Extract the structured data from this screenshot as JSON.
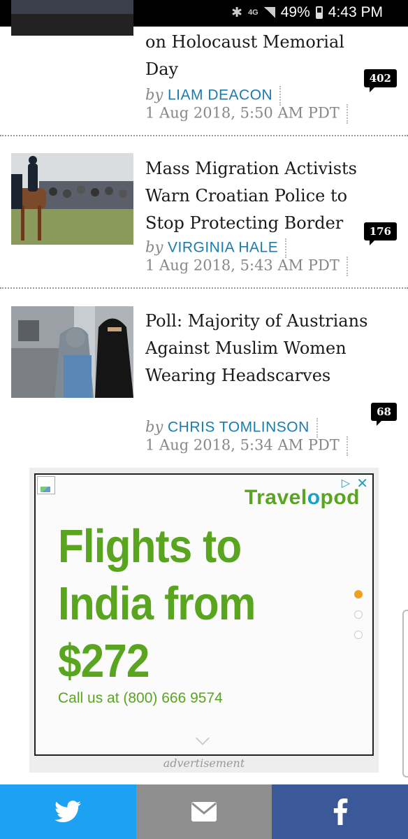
{
  "status_bar": {
    "network": "4G",
    "battery": "49%",
    "time": "4:43 PM"
  },
  "articles": [
    {
      "title": "on Holocaust Memorial Day",
      "by": "by",
      "author": "LIAM DEACON",
      "date": "1 Aug 2018, 5:50 AM PDT",
      "comments": "402"
    },
    {
      "title": "Mass Migration Activists Warn Croatian Police to Stop Protecting Border",
      "by": "by",
      "author": "VIRGINIA HALE",
      "date": "1 Aug 2018, 5:43 AM PDT",
      "comments": "176"
    },
    {
      "title": "Poll: Majority of Austrians Against Muslim Women Wearing Headscarves",
      "by": "by",
      "author": "CHRIS TOMLINSON",
      "date": "1 Aug 2018, 5:34 AM PDT",
      "comments": "68"
    }
  ],
  "ad": {
    "logo_a": "Travel",
    "logo_o": "o",
    "logo_b": "pod",
    "headline": "Flights to India from $272",
    "call": "Call us at (800) 666 9574",
    "label": "advertisement",
    "brand_color": "#5aa520",
    "accent_color": "#1aa1c8"
  },
  "share_bar": {
    "twitter_color": "#1da1f2",
    "email_color": "#8f8f8f",
    "facebook_color": "#3b5998"
  }
}
